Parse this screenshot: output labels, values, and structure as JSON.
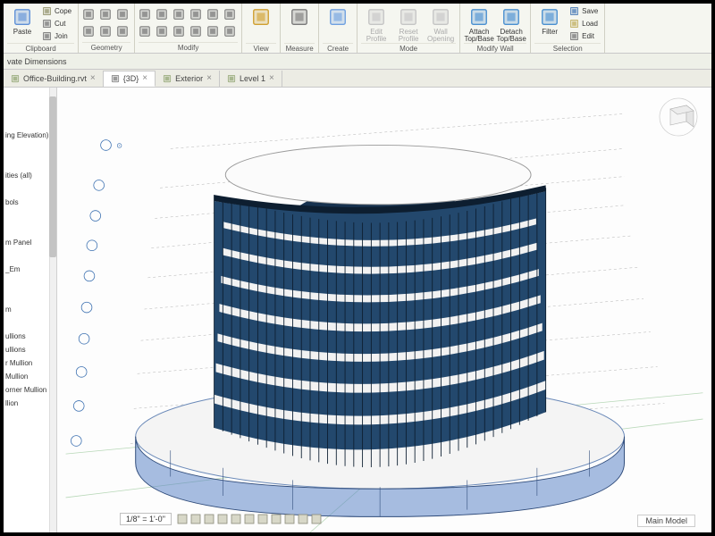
{
  "ribbon": {
    "panels": [
      {
        "title": "Clipboard",
        "items": [
          {
            "t": "big",
            "label": "Paste",
            "icon": "paste"
          }
        ],
        "minis": [
          {
            "label": "Cope",
            "icon": "cope"
          },
          {
            "label": "Cut",
            "icon": "cut"
          },
          {
            "label": "Join",
            "icon": "join"
          }
        ]
      },
      {
        "title": "Geometry",
        "icons": [
          "extrude",
          "void",
          "sweep",
          "blend",
          "pick",
          "align"
        ]
      },
      {
        "title": "Modify",
        "icons": [
          "move",
          "copy",
          "rotate",
          "mirror",
          "array",
          "scale",
          "trim",
          "extend",
          "split",
          "offset",
          "pin",
          "unpin"
        ]
      },
      {
        "title": "View",
        "items": [
          {
            "t": "big",
            "label": "",
            "icon": "view"
          }
        ]
      },
      {
        "title": "Measure",
        "items": [
          {
            "t": "big",
            "label": "",
            "icon": "measure"
          }
        ]
      },
      {
        "title": "Create",
        "items": [
          {
            "t": "big",
            "label": "",
            "icon": "create"
          }
        ]
      },
      {
        "title": "Mode",
        "disabled": true,
        "items": [
          {
            "t": "big",
            "label": "Edit\nProfile",
            "icon": "editp"
          },
          {
            "t": "big",
            "label": "Reset\nProfile",
            "icon": "resetp"
          },
          {
            "t": "big",
            "label": "Wall\nOpening",
            "icon": "wallop"
          }
        ]
      },
      {
        "title": "Modify Wall",
        "items": [
          {
            "t": "big",
            "label": "Attach\nTop/Base",
            "icon": "attach"
          },
          {
            "t": "big",
            "label": "Detach\nTop/Base",
            "icon": "detach"
          }
        ]
      },
      {
        "title": "Selection",
        "items": [
          {
            "t": "big",
            "label": "Filter",
            "icon": "filter"
          }
        ],
        "minis": [
          {
            "label": "Save",
            "icon": "save"
          },
          {
            "label": "Load",
            "icon": "load"
          },
          {
            "label": "Edit",
            "icon": "edit"
          }
        ]
      }
    ]
  },
  "sub_bar": {
    "label": "vate Dimensions"
  },
  "tabs": [
    {
      "label": "Office-Building.rvt",
      "active": false,
      "icon": "doc"
    },
    {
      "label": "{3D}",
      "active": true,
      "icon": "3d"
    },
    {
      "label": "Exterior",
      "active": false,
      "icon": "elev"
    },
    {
      "label": "Level 1",
      "active": false,
      "icon": "plan"
    }
  ],
  "side_items": [
    "",
    "",
    "",
    "ing Elevation)",
    "",
    "",
    "ities (all)",
    "",
    "bols",
    "",
    "",
    "m Panel",
    "",
    "_Em",
    "",
    "",
    "m",
    "",
    "ullions",
    "ullions",
    "r Mullion",
    "Mullion",
    "orner Mullion",
    "llion"
  ],
  "status": {
    "scale": "1/8\" = 1'-0\"",
    "icons": [
      "g1",
      "g2",
      "g3",
      "g4",
      "g5",
      "g6",
      "g7",
      "g8",
      "g9",
      "g10",
      "g11"
    ]
  },
  "main_model": "Main Model",
  "icons": {
    "paste": "#5d8fd6",
    "cope": "#8a8a60",
    "cut": "#6a6a6a",
    "join": "#6a6a6a",
    "view": "#d0a030",
    "measure": "#7a7a7a",
    "create": "#6fa0e0",
    "editp": "#c5c5c5",
    "resetp": "#c5c5c5",
    "wallop": "#c5c5c5",
    "attach": "#4a90d0",
    "detach": "#4a90d0",
    "filter": "#4a90d0",
    "save": "#3a6fb0",
    "load": "#bba850",
    "edit": "#6a6a6a",
    "doc": "#8aa06a",
    "3d": "#707070",
    "elev": "#8aa06a",
    "plan": "#8aa06a"
  }
}
